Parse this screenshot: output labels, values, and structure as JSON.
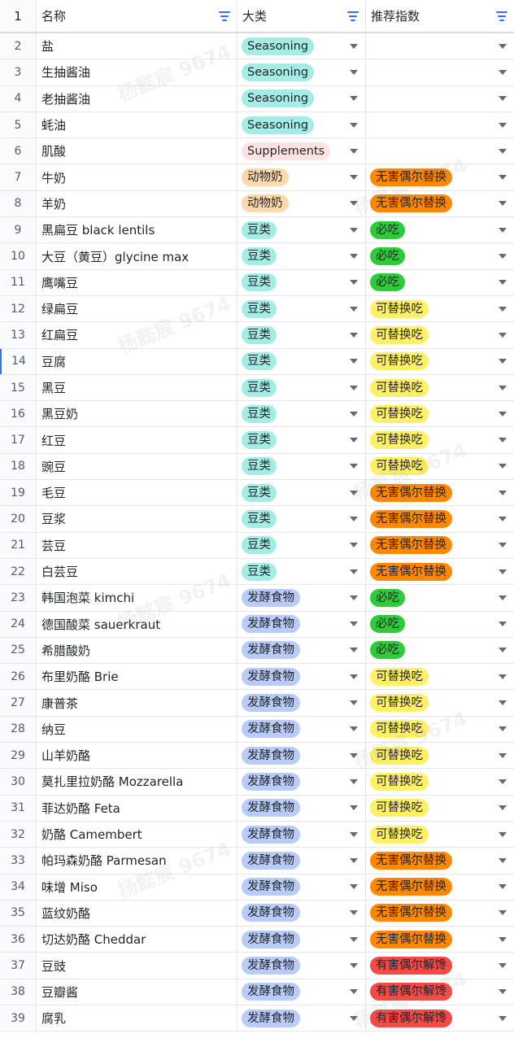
{
  "headers": {
    "name": "名称",
    "category": "大类",
    "recommend": "推荐指数"
  },
  "watermark": "杨懿宸 9674",
  "colors": {
    "Seasoning": "#a4ede4",
    "Supplements": "#fde2e2",
    "动物奶": "#fdd8a9",
    "豆类": "#a4ede4",
    "发酵食物": "#b9ccf9",
    "无害偶尔替换": "#ff8800",
    "必吃": "#2ecc3a",
    "可替换吃": "#fff066",
    "有害偶尔解馋": "#f54a45"
  },
  "rows": [
    {
      "n": "1",
      "name": "",
      "cat": "",
      "rec": ""
    },
    {
      "n": "2",
      "name": "盐",
      "cat": "Seasoning",
      "rec": ""
    },
    {
      "n": "3",
      "name": "生抽酱油",
      "cat": "Seasoning",
      "rec": ""
    },
    {
      "n": "4",
      "name": "老抽酱油",
      "cat": "Seasoning",
      "rec": ""
    },
    {
      "n": "5",
      "name": "蚝油",
      "cat": "Seasoning",
      "rec": ""
    },
    {
      "n": "6",
      "name": "肌酸",
      "cat": "Supplements",
      "rec": ""
    },
    {
      "n": "7",
      "name": "牛奶",
      "cat": "动物奶",
      "rec": "无害偶尔替换"
    },
    {
      "n": "8",
      "name": "羊奶",
      "cat": "动物奶",
      "rec": "无害偶尔替换"
    },
    {
      "n": "9",
      "name": "黑扁豆 black lentils",
      "cat": "豆类",
      "rec": "必吃"
    },
    {
      "n": "10",
      "name": "大豆（黄豆）glycine max",
      "cat": "豆类",
      "rec": "必吃"
    },
    {
      "n": "11",
      "name": "鹰嘴豆",
      "cat": "豆类",
      "rec": "必吃"
    },
    {
      "n": "12",
      "name": "绿扁豆",
      "cat": "豆类",
      "rec": "可替换吃"
    },
    {
      "n": "13",
      "name": "红扁豆",
      "cat": "豆类",
      "rec": "可替换吃"
    },
    {
      "n": "14",
      "name": "豆腐",
      "cat": "豆类",
      "rec": "可替换吃"
    },
    {
      "n": "15",
      "name": "黑豆",
      "cat": "豆类",
      "rec": "可替换吃"
    },
    {
      "n": "16",
      "name": "黑豆奶",
      "cat": "豆类",
      "rec": "可替换吃"
    },
    {
      "n": "17",
      "name": "红豆",
      "cat": "豆类",
      "rec": "可替换吃"
    },
    {
      "n": "18",
      "name": "豌豆",
      "cat": "豆类",
      "rec": "可替换吃"
    },
    {
      "n": "19",
      "name": "毛豆",
      "cat": "豆类",
      "rec": "无害偶尔替换"
    },
    {
      "n": "20",
      "name": "豆浆",
      "cat": "豆类",
      "rec": "无害偶尔替换"
    },
    {
      "n": "21",
      "name": "芸豆",
      "cat": "豆类",
      "rec": "无害偶尔替换"
    },
    {
      "n": "22",
      "name": "白芸豆",
      "cat": "豆类",
      "rec": "无害偶尔替换"
    },
    {
      "n": "23",
      "name": "韩国泡菜 kimchi",
      "cat": "发酵食物",
      "rec": "必吃"
    },
    {
      "n": "24",
      "name": "德国酸菜 sauerkraut",
      "cat": "发酵食物",
      "rec": "必吃"
    },
    {
      "n": "25",
      "name": "希腊酸奶",
      "cat": "发酵食物",
      "rec": "必吃"
    },
    {
      "n": "26",
      "name": "布里奶酪 Brie",
      "cat": "发酵食物",
      "rec": "可替换吃"
    },
    {
      "n": "27",
      "name": "康普茶",
      "cat": "发酵食物",
      "rec": "可替换吃"
    },
    {
      "n": "28",
      "name": "纳豆",
      "cat": "发酵食物",
      "rec": "可替换吃"
    },
    {
      "n": "29",
      "name": "山羊奶酪",
      "cat": "发酵食物",
      "rec": "可替换吃"
    },
    {
      "n": "30",
      "name": "莫扎里拉奶酪 Mozzarella",
      "cat": "发酵食物",
      "rec": "可替换吃"
    },
    {
      "n": "31",
      "name": "菲达奶酪 Feta",
      "cat": "发酵食物",
      "rec": "可替换吃"
    },
    {
      "n": "32",
      "name": "奶酪 Camembert",
      "cat": "发酵食物",
      "rec": "可替换吃"
    },
    {
      "n": "33",
      "name": "帕玛森奶酪 Parmesan",
      "cat": "发酵食物",
      "rec": "无害偶尔替换"
    },
    {
      "n": "34",
      "name": "味增 Miso",
      "cat": "发酵食物",
      "rec": "无害偶尔替换"
    },
    {
      "n": "35",
      "name": "蓝纹奶酪",
      "cat": "发酵食物",
      "rec": "无害偶尔替换"
    },
    {
      "n": "36",
      "name": "切达奶酪 Cheddar",
      "cat": "发酵食物",
      "rec": "无害偶尔替换"
    },
    {
      "n": "37",
      "name": "豆豉",
      "cat": "发酵食物",
      "rec": "有害偶尔解馋"
    },
    {
      "n": "38",
      "name": "豆瓣酱",
      "cat": "发酵食物",
      "rec": "有害偶尔解馋"
    },
    {
      "n": "39",
      "name": "腐乳",
      "cat": "发酵食物",
      "rec": "有害偶尔解馋"
    }
  ]
}
